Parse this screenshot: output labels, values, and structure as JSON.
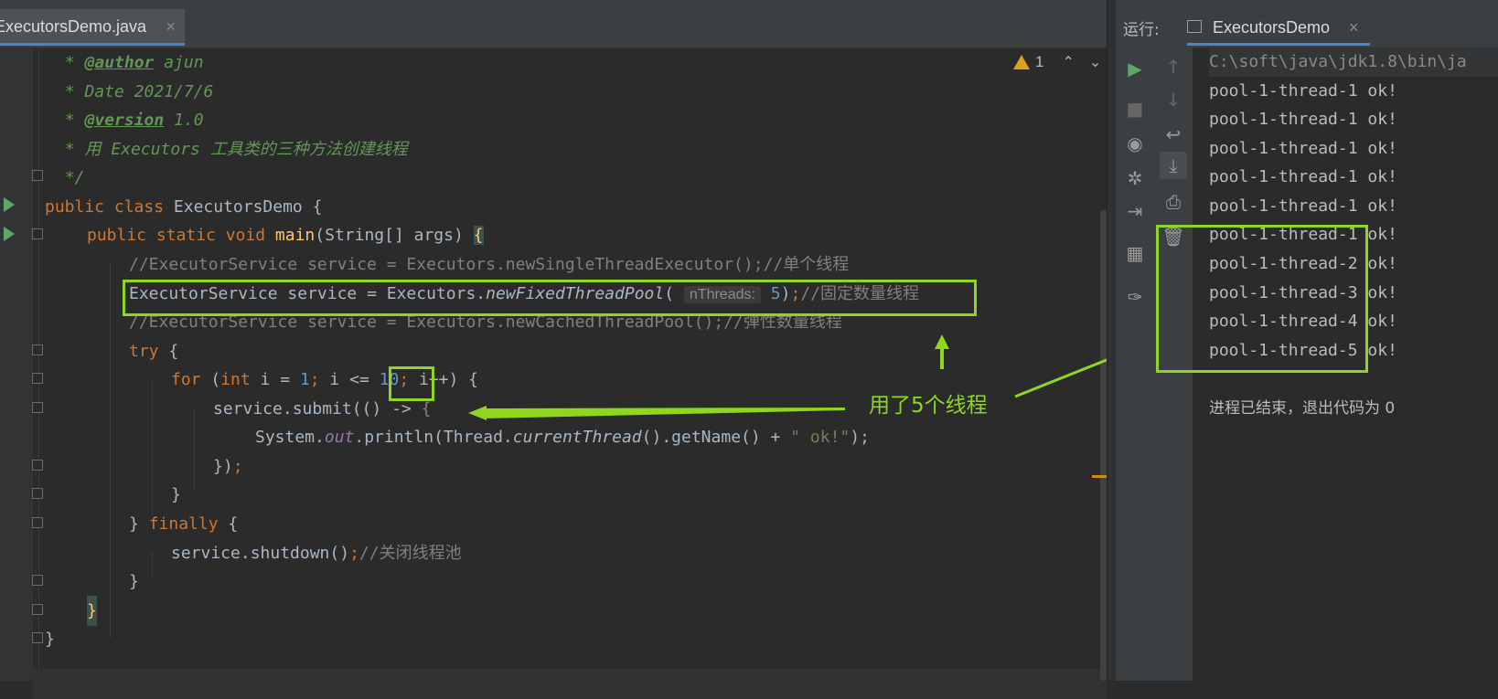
{
  "editor": {
    "tab_label": "ExecutorsDemo.java",
    "tab_close": "×",
    "warning_count": "1",
    "chevron_up": "⌃",
    "chevron_down": "⌄",
    "lines": {
      "l1_star": " * ",
      "l1_tag": "@author",
      "l1_rest": " ajun",
      "l2": " * Date 2021/7/6",
      "l3_star": " * ",
      "l3_tag": "@version",
      "l3_rest": " 1.0",
      "l4": " * 用 Executors 工具类的三种方法创建线程",
      "l5": " */",
      "l6_kw": "public class ",
      "l6_rest": "ExecutorsDemo {",
      "l7_kw": "public static void ",
      "l7_fn": "main",
      "l7_rest": "(String[] args) ",
      "l7_brace": "{",
      "l8": "//ExecutorService service = Executors.newSingleThreadExecutor();//单个线程",
      "l9_a": "ExecutorService service = Executors.",
      "l9_fn": "newFixedThreadPool",
      "l9_b": "( ",
      "l9_hint": "nThreads:",
      "l9_num": " 5",
      "l9_c": ")",
      "l9_semi": ";",
      "l9_cm": "//固定数量线程",
      "l10": "//ExecutorService service = Executors.newCachedThreadPool();//弹性数量线程",
      "l11_kw": "try",
      "l11_rest": " {",
      "l12_kw": "for",
      "l12_a": " (",
      "l12_kw2": "int",
      "l12_b": " i = ",
      "l12_n1": "1",
      "l12_s1": ";",
      "l12_c": " i <= ",
      "l12_n2": "10",
      "l12_s2": ";",
      "l12_d": " i++) {",
      "l13_a": "service.submit(() -> ",
      "l13_b": "{",
      "l14_a": "System.",
      "l14_fld": "out",
      "l14_b": ".println(Thread.",
      "l14_it": "currentThread",
      "l14_c": "().getName() + ",
      "l14_str": "\" ok!\"",
      "l14_d": ");",
      "l15_a": "})",
      "l15_semi": ";",
      "l16": "}",
      "l17_a": "} ",
      "l17_kw": "finally",
      "l17_b": " {",
      "l18_a": "service.shutdown()",
      "l18_semi": ";",
      "l18_cm": "//关闭线程池",
      "l19": "}",
      "l20": "}",
      "l21": "}"
    },
    "annotation": "用了5个线程"
  },
  "run": {
    "label": "运行:",
    "tab_label": "ExecutorsDemo",
    "tab_close": "×",
    "cmd": "C:\\soft\\java\\jdk1.8\\bin\\ja",
    "output": [
      "pool-1-thread-1 ok!",
      "pool-1-thread-1 ok!",
      "pool-1-thread-1 ok!",
      "pool-1-thread-1 ok!",
      "pool-1-thread-1 ok!",
      "pool-1-thread-1 ok!",
      "pool-1-thread-2 ok!",
      "pool-1-thread-3 ok!",
      "pool-1-thread-4 ok!",
      "pool-1-thread-5 ok!"
    ],
    "exit_message": "进程已结束，退出代码为 0"
  },
  "colors": {
    "accent_green": "#8ed61f",
    "run_green": "#59a869",
    "keyword": "#cc7832"
  }
}
